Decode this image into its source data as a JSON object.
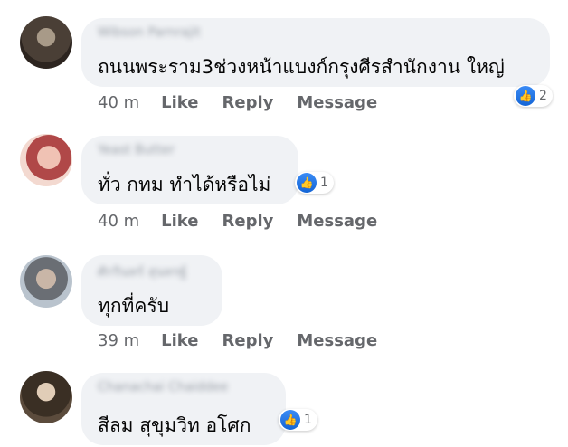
{
  "comments": [
    {
      "author": "Wibson Parnrajit",
      "text": "ถนนพระราม3ช่วงหน้าแบงก์กรุงศีรสำนักงาน ใหญ่",
      "reactions": "2",
      "time": "40 m",
      "like": "Like",
      "reply": "Reply",
      "message": "Message"
    },
    {
      "author": "Yeast Butter",
      "text": "ทั่ว กทม ทำได้หรือไม่",
      "reactions": "1",
      "time": "40 m",
      "like": "Like",
      "reply": "Reply",
      "message": "Message"
    },
    {
      "author": "ศักรินทร์ สุนทรฐ์",
      "text": "ทุกที่ครับ",
      "time": "39 m",
      "like": "Like",
      "reply": "Reply",
      "message": "Message"
    },
    {
      "author": "Chanachai Chaiddee",
      "text": "สีลม สุขุมวิท อโศก",
      "reactions": "1"
    }
  ],
  "icons": {
    "reaction": "like-thumb-icon"
  },
  "colors": {
    "like_blue": "#1877f2",
    "bubble": "#f0f2f5",
    "meta_text": "#65676b"
  }
}
